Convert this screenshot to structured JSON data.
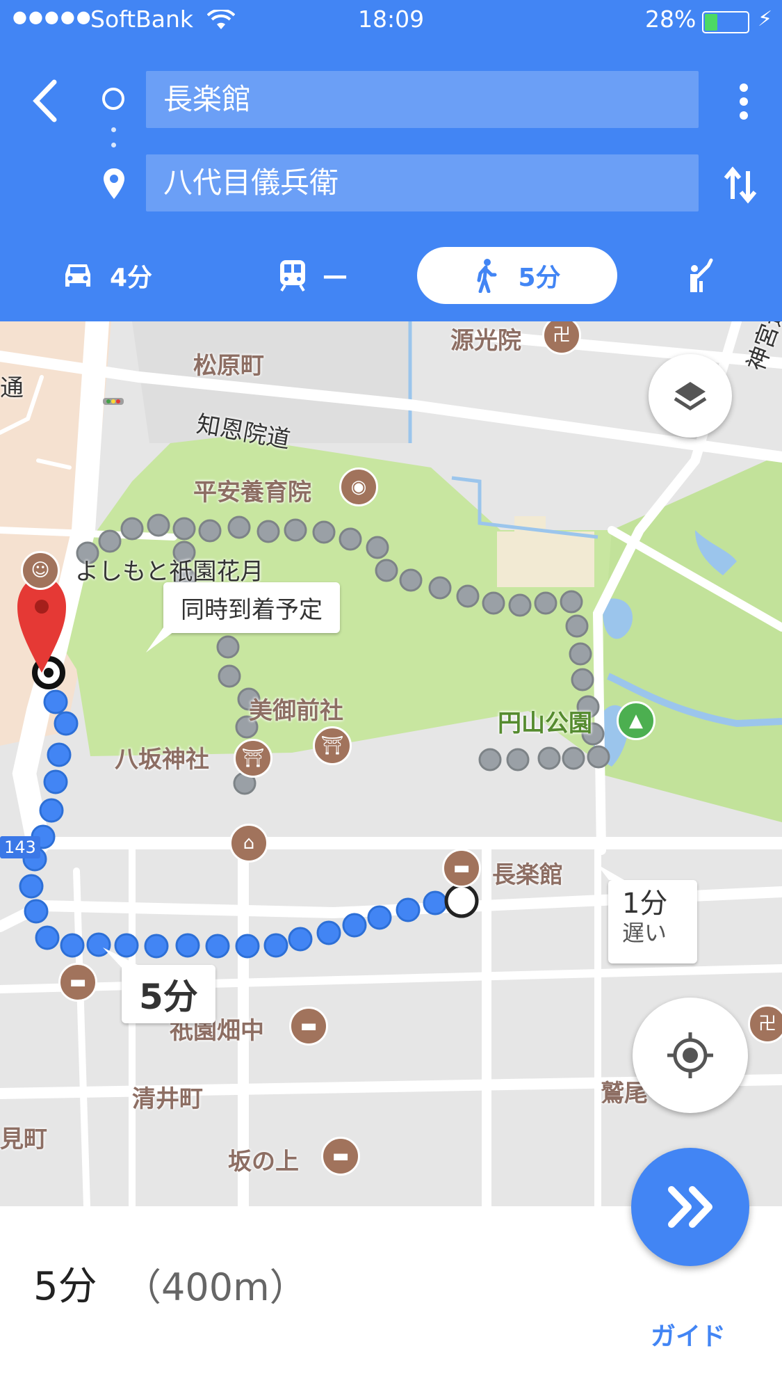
{
  "status_bar": {
    "carrier": "SoftBank",
    "time": "18:09",
    "battery": "28%"
  },
  "search": {
    "origin": "長楽館",
    "destination": "八代目儀兵衛"
  },
  "modes": [
    {
      "name": "car",
      "label": "4分"
    },
    {
      "name": "transit",
      "label": "—"
    },
    {
      "name": "walk",
      "label": "5分",
      "selected": true
    },
    {
      "name": "ride",
      "label": ""
    }
  ],
  "map": {
    "labels": {
      "genkouin": "源光院",
      "matsubara": "松原町",
      "chion_in_dori": "知恩院道",
      "heian_yoikuin": "平安養育院",
      "yoshimoto": "よしもと祇園花月",
      "migosha": "美御前社",
      "yasaka": "八坂神社",
      "maruyama": "円山公園",
      "chorakukan": "長楽館",
      "gion_hatanaka": "祇園畑中",
      "kiyoi": "清井町",
      "sakanoue": "坂の上",
      "jingu_michi": "神宮道",
      "dori_left": "通",
      "mimachi": "見町",
      "washio": "鷲尾",
      "route_143": "143"
    },
    "callouts": {
      "arrive_same": "同時到着予定",
      "route_time": "5分",
      "alt_line1": "1分",
      "alt_line2": "遅い"
    }
  },
  "summary": {
    "duration": "5分",
    "distance": "（400m）",
    "guide": "ガイド"
  },
  "colors": {
    "primary": "#4285f4",
    "route": "#4285f4",
    "alt_route": "#9aa0a6",
    "park": "#c8e6a0",
    "poi": "#a1735c"
  }
}
